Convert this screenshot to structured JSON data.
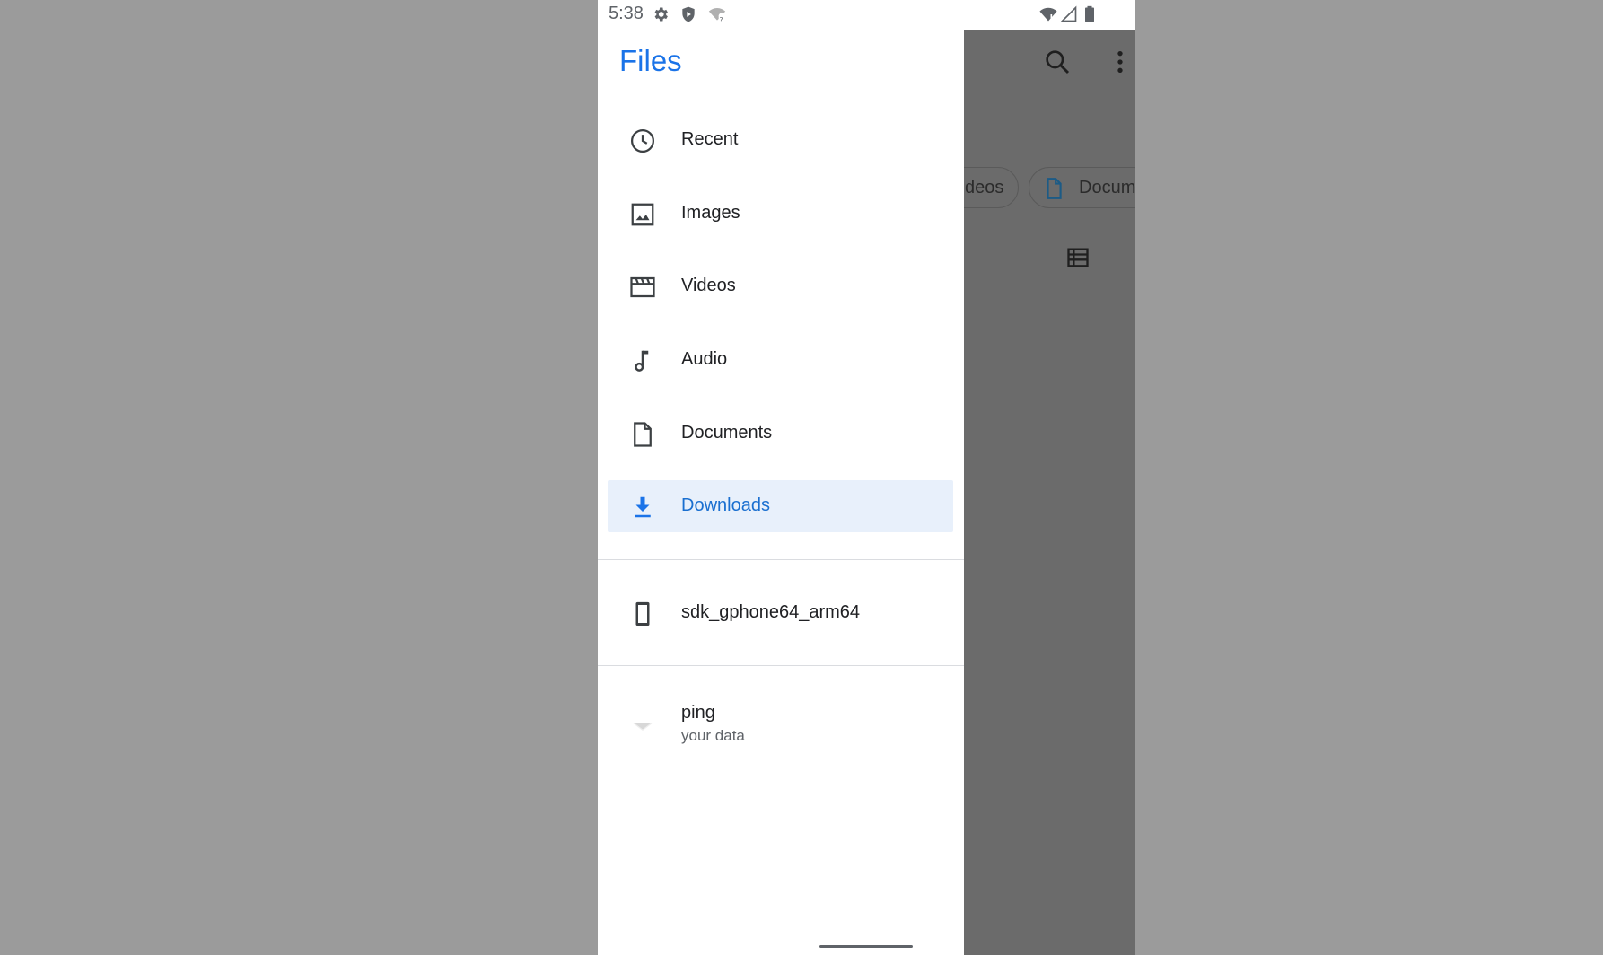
{
  "status_bar": {
    "time": "5:38",
    "left_icons": [
      "settings-gear-icon",
      "shield-play-icon",
      "wifi-unknown-icon"
    ],
    "right_icons": [
      "wifi-icon",
      "signal-icon",
      "battery-icon"
    ]
  },
  "drawer": {
    "title": "Files",
    "items": [
      {
        "label": "Recent",
        "icon": "clock-icon"
      },
      {
        "label": "Images",
        "icon": "image-icon"
      },
      {
        "label": "Videos",
        "icon": "video-clapper-icon"
      },
      {
        "label": "Audio",
        "icon": "music-note-icon"
      },
      {
        "label": "Documents",
        "icon": "document-icon"
      },
      {
        "label": "Downloads",
        "icon": "download-icon",
        "selected": true
      }
    ],
    "device": {
      "label": "sdk_gphone64_arm64",
      "icon": "phone-device-icon"
    },
    "root": {
      "label": "ping",
      "sublabel": "your data",
      "icon": "app-icon"
    }
  },
  "background_app": {
    "chips": [
      {
        "label": "Videos",
        "visible_text": "deos"
      },
      {
        "label": "Documents",
        "visible_text": "Docum",
        "icon": "document-icon"
      }
    ],
    "icons": [
      "search-icon",
      "more-vert-icon",
      "list-view-icon"
    ]
  },
  "colors": {
    "accent": "#1a73e8",
    "selected_bg": "#e8f0fb",
    "scrim": "#6b6b6b",
    "outer_bg": "#9b9b9b"
  }
}
